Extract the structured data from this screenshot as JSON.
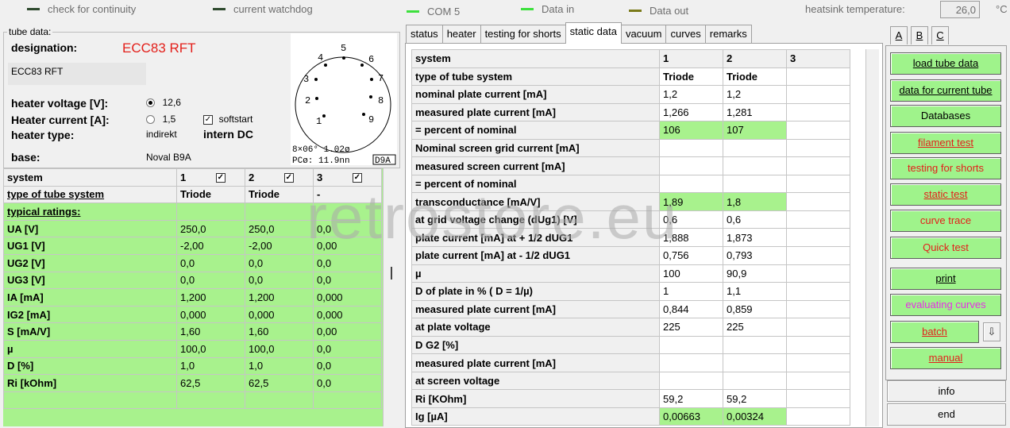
{
  "status_bar": {
    "items": [
      {
        "label": "check for continuity",
        "color": "#2e4a2e"
      },
      {
        "label": "current watchdog",
        "color": "#2e4a2e"
      },
      {
        "label": "COM 5",
        "color": "#3de03d"
      },
      {
        "label": "Data in",
        "color": "#3de03d"
      },
      {
        "label": "Data out",
        "color": "#7a7a1a"
      }
    ],
    "heatsink_label": "heatsink temperature:",
    "heatsink_value": "26,0",
    "heatsink_unit": "°C"
  },
  "tube": {
    "legend": "tube data:",
    "designation_label": "designation:",
    "designation_value": "ECC83 RFT",
    "name_field": "ECC83 RFT",
    "heater_voltage_label": "heater voltage [V]:",
    "heater_current_label": "Heater current [A]:",
    "heater_type_label": "heater type:",
    "base_label": "base:",
    "voltage_option_1": "12,6",
    "voltage_option_2": "1,5",
    "softstart_label": "softstart",
    "heater_type_value": "indirekt",
    "heater_mode": "intern DC",
    "base_value": "Noval B9A",
    "diagram_text_1": "8×06° 1.02ø",
    "diagram_text_2": "PCø: 11.9nn",
    "diagram_code": "D9A",
    "pins": [
      "1",
      "2",
      "3",
      "4",
      "5",
      "6",
      "7",
      "8",
      "9"
    ]
  },
  "left_table": {
    "header": [
      "system",
      "1",
      "2",
      "3"
    ],
    "type_row": [
      "type of tube system",
      "Triode",
      "Triode",
      "-"
    ],
    "typical_label": "typical ratings:",
    "rows": [
      [
        "UA [V]",
        "250,0",
        "250,0",
        "0,0"
      ],
      [
        "UG1 [V]",
        "-2,00",
        "-2,00",
        "0,00"
      ],
      [
        "UG2 [V]",
        "0,0",
        "0,0",
        "0,0"
      ],
      [
        "UG3 [V]",
        "0,0",
        "0,0",
        "0,0"
      ],
      [
        "IA [mA]",
        "1,200",
        "1,200",
        "0,000"
      ],
      [
        "IG2 [mA]",
        "0,000",
        "0,000",
        "0,000"
      ],
      [
        "S [mA/V]",
        "1,60",
        "1,60",
        "0,00"
      ],
      [
        "µ",
        "100,0",
        "100,0",
        "0,0"
      ],
      [
        "D [%]",
        "1,0",
        "1,0",
        "0,0"
      ],
      [
        "Ri [kOhm]",
        "62,5",
        "62,5",
        "0,0"
      ]
    ]
  },
  "tabs": [
    "status",
    "heater",
    "testing for shorts",
    "static data",
    "vacuum",
    "curves",
    "remarks"
  ],
  "main_table": {
    "header": [
      "system",
      "1",
      "2",
      "3"
    ],
    "rows": [
      {
        "label": "type of tube system",
        "v1": "Triode",
        "v2": "Triode",
        "v3": "",
        "hl": false,
        "bold": true
      },
      {
        "label": "nominal plate current [mA]",
        "v1": "1,2",
        "v2": "1,2",
        "v3": "",
        "hl": false
      },
      {
        "label": "measured plate current [mA]",
        "v1": "1,266",
        "v2": "1,281",
        "v3": "",
        "hl": false
      },
      {
        "label": "= percent of nominal",
        "v1": "106",
        "v2": "107",
        "v3": "",
        "hl": true
      },
      {
        "label": "Nominal screen grid current [mA]",
        "v1": "",
        "v2": "",
        "v3": "",
        "hl": false
      },
      {
        "label": "measured screen current [mA]",
        "v1": "",
        "v2": "",
        "v3": "",
        "hl": false
      },
      {
        "label": "= percent of nominal",
        "v1": "",
        "v2": "",
        "v3": "",
        "hl": false
      },
      {
        "label": "transconductance [mA/V]",
        "v1": "1,89",
        "v2": "1,8",
        "v3": "",
        "hl": true
      },
      {
        "label": "at grid voltage change (dUg1) [V]",
        "v1": "0,6",
        "v2": "0,6",
        "v3": "",
        "hl": false
      },
      {
        "label": "plate current [mA] at + 1/2 dUG1",
        "v1": "1,888",
        "v2": "1,873",
        "v3": "",
        "hl": false
      },
      {
        "label": "plate current [mA] at - 1/2 dUG1",
        "v1": "0,756",
        "v2": "0,793",
        "v3": "",
        "hl": false
      },
      {
        "label": "µ",
        "v1": "100",
        "v2": "90,9",
        "v3": "",
        "hl": false
      },
      {
        "label": "D of plate in % ( D = 1/µ)",
        "v1": "1",
        "v2": "1,1",
        "v3": "",
        "hl": false
      },
      {
        "label": "measured plate current [mA]",
        "v1": "0,844",
        "v2": "0,859",
        "v3": "",
        "hl": false
      },
      {
        "label": "at plate voltage",
        "v1": "225",
        "v2": "225",
        "v3": "",
        "hl": false
      },
      {
        "label": "D G2 [%]",
        "v1": "",
        "v2": "",
        "v3": "",
        "hl": false
      },
      {
        "label": "measured plate current [mA]",
        "v1": "",
        "v2": "",
        "v3": "",
        "hl": false
      },
      {
        "label": "at screen voltage",
        "v1": "",
        "v2": "",
        "v3": "",
        "hl": false
      },
      {
        "label": "Ri [KOhm]",
        "v1": "59,2",
        "v2": "59,2",
        "v3": "",
        "hl": false
      },
      {
        "label": "Ig [µA]",
        "v1": "0,00663",
        "v2": "0,00324",
        "v3": "",
        "hl": true
      }
    ]
  },
  "right_tabs": [
    "A",
    "B",
    "C"
  ],
  "buttons": {
    "load_tube_data": "load tube data",
    "data_for_current_tube": "data for current tube",
    "databases": "Databases",
    "filament_test": "filament test",
    "testing_for_shorts": "testing for shorts",
    "static_test": "static test",
    "curve_trace": "curve trace",
    "quick_test": "Quick test",
    "print": "print",
    "evaluating_curves": "evaluating curves",
    "batch": "batch",
    "batch_arrow": "⇩",
    "manual": "manual",
    "info": "info",
    "end": "end"
  },
  "watermark": "retrostore.eu"
}
